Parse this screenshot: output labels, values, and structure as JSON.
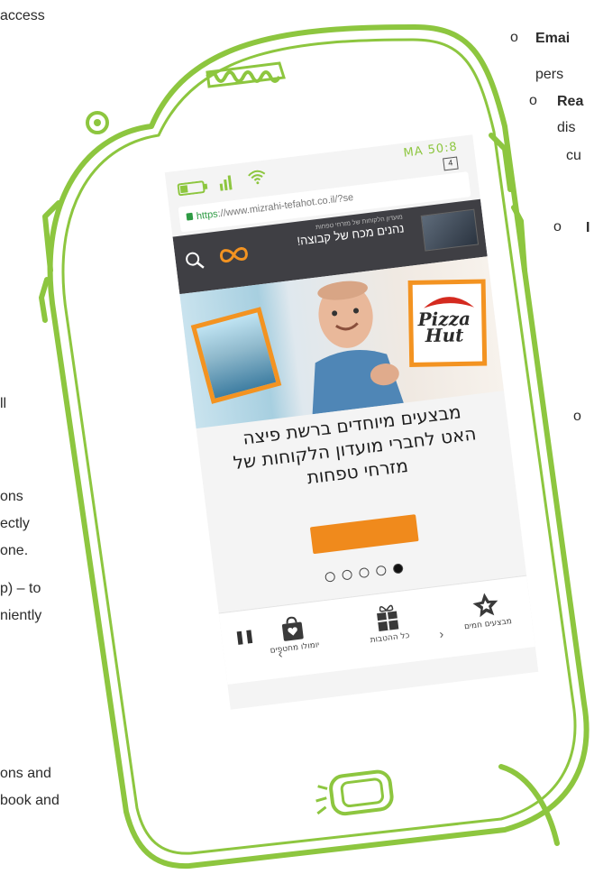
{
  "background_text": {
    "top_left": "access",
    "left_fragments": [
      "ll",
      "ons",
      "ectly",
      "one.",
      "p) – to",
      "niently",
      "ons and",
      "book and"
    ],
    "right_items": [
      {
        "bold": "Emai",
        "rest": "pers"
      },
      {
        "bold": "Rea",
        "rest": "dis"
      },
      {
        "bold": "",
        "rest": "cu"
      },
      {
        "bold": "I",
        "rest": ""
      }
    ]
  },
  "phone": {
    "status_time": "MA 50:8",
    "tab_count": "4",
    "url_https": "https",
    "url_rest": "://www.mizrahi-tefahot.co.il/?se"
  },
  "site": {
    "header_small": "מועדון הלקוחות של מזרחי טפחות",
    "header_title": "נהנים מכח של קבוצה!",
    "hero_brand": "Pizza Hut",
    "promo_lines": [
      "מבצעים מיוחדים ברשת פיצה",
      "האט לחברי מועדון הלקוחות של",
      "מזרחי טפחות"
    ],
    "cta_label": "",
    "slides": 5,
    "active_slide": 5,
    "nav": [
      {
        "label": "יומולו מחטפים",
        "icon": "bag-heart-icon"
      },
      {
        "label": "כל ההטבות",
        "icon": "gift-icon"
      },
      {
        "label": "מבצעים חמים",
        "icon": "star-icon"
      }
    ]
  },
  "colors": {
    "frame": "#8dc63f",
    "accent": "#f08a1c",
    "header": "#3f3f44"
  }
}
